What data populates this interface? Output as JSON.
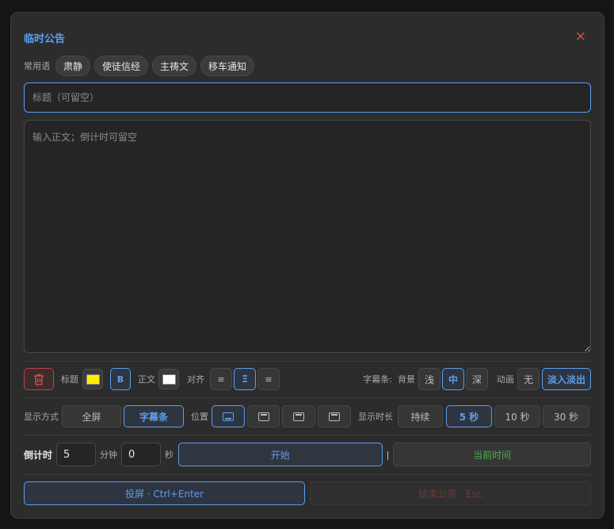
{
  "dialog": {
    "title": "临时公告",
    "close_glyph": "×"
  },
  "phrases": {
    "label": "常用语",
    "items": [
      "肃静",
      "使徒信经",
      "主祷文",
      "移车通知"
    ]
  },
  "inputs": {
    "title_placeholder": "标题（可留空）",
    "title_value": "",
    "body_placeholder": "输入正文；倒计时可留空",
    "body_value": ""
  },
  "style_row": {
    "title_label": "标题",
    "title_color": "#ffee00",
    "bold_label": "B",
    "body_label": "正文",
    "body_color": "#ffffff",
    "align_label": "对齐",
    "ticker_label": "字幕条:",
    "bg_label": "背景",
    "bg_options": [
      "浅",
      "中",
      "深"
    ],
    "bg_selected": "中",
    "anim_label": "动画",
    "anim_options": [
      "无",
      "淡入淡出"
    ],
    "anim_selected": "淡入淡出"
  },
  "display_row": {
    "mode_label": "显示方式",
    "mode_options": [
      "全屏",
      "字幕条"
    ],
    "mode_selected": "字幕条",
    "position_label": "位置",
    "duration_label": "显示时长",
    "duration_options": [
      "持续",
      "5 秒",
      "10 秒",
      "30 秒"
    ],
    "duration_selected": "5 秒"
  },
  "countdown": {
    "label": "倒计时",
    "minutes": "5",
    "minutes_unit": "分钟",
    "seconds": "0",
    "seconds_unit": "秒",
    "start_label": "开始",
    "separator": "|",
    "now_label": "当前时间"
  },
  "actions": {
    "project_label": "投屏 · Ctrl+Enter",
    "end_label": "结束公告 · Esc"
  },
  "colors": {
    "accent": "#5b9fee",
    "danger": "#d9534f",
    "success": "#4cae4c"
  }
}
